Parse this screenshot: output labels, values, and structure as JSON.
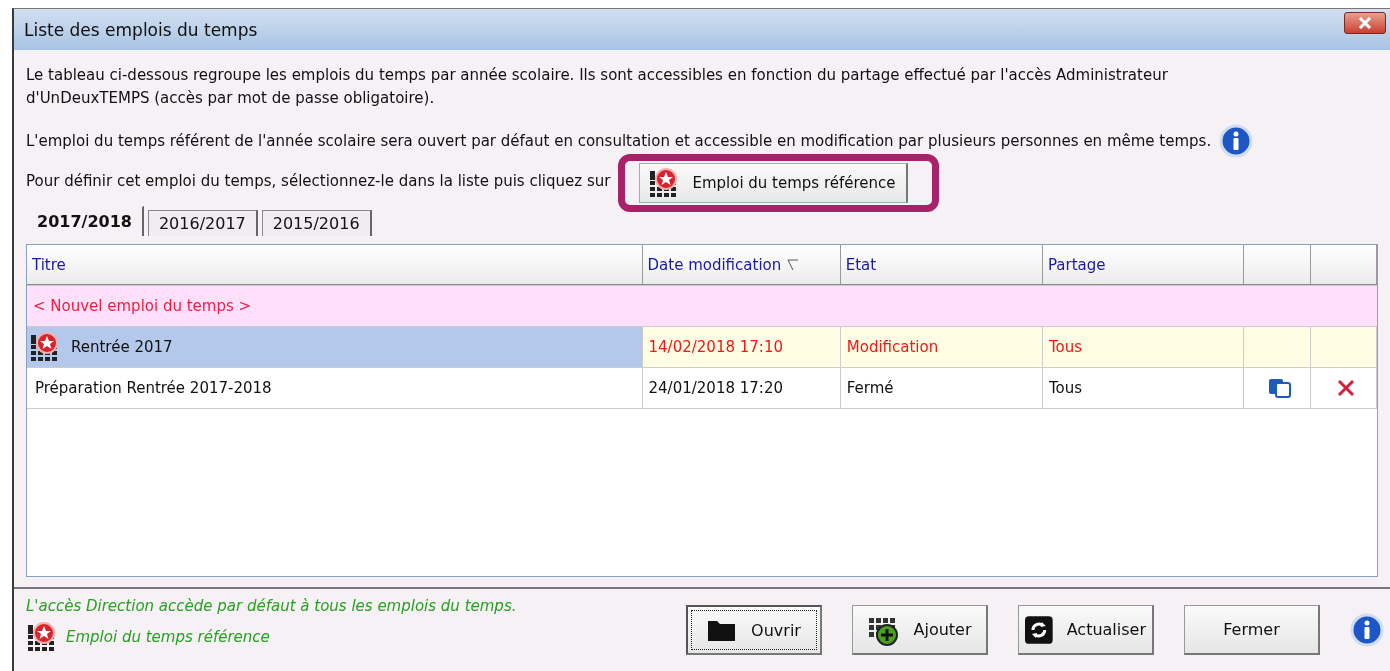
{
  "window": {
    "title": "Liste des emplois du temps"
  },
  "intro": "Le tableau ci-dessous regroupe les emplois du temps par année scolaire. Ils sont accessibles en fonction du partage effectué par l'accès Administrateur d'UnDeuxTEMPS (accès par mot de passe obligatoire).",
  "info_text": "L'emploi du temps référent de l'année scolaire sera ouvert par défaut en consultation et accessible en modification par plusieurs personnes en même temps.",
  "define_text": "Pour définir cet emploi du temps, sélectionnez-le dans la liste puis cliquez sur",
  "reference_button": {
    "label": "Emploi du temps référence",
    "highlighted": true
  },
  "tabs": [
    {
      "label": "2017/2018",
      "selected": true
    },
    {
      "label": "2016/2017",
      "selected": false
    },
    {
      "label": "2015/2016",
      "selected": false
    }
  ],
  "table": {
    "columns": [
      {
        "label": "Titre",
        "sorted": false
      },
      {
        "label": "Date modification",
        "sorted": true
      },
      {
        "label": "Etat",
        "sorted": false
      },
      {
        "label": "Partage",
        "sorted": false
      }
    ],
    "new_row": "< Nouvel emploi du temps >",
    "rows": [
      {
        "title": "Rentrée 2017",
        "reference": true,
        "selected": true,
        "modified": true,
        "date": "14/02/2018 17:10",
        "state": "Modification",
        "share": "Tous",
        "actions": false
      },
      {
        "title": "Préparation Rentrée 2017-2018",
        "reference": false,
        "selected": false,
        "modified": false,
        "date": "24/01/2018 17:20",
        "state": "Fermé",
        "share": "Tous",
        "actions": true
      }
    ]
  },
  "footer": {
    "note": "L'accès Direction accède par défaut à tous les emplois du temps.",
    "legend": "Emploi du temps référence"
  },
  "buttons": [
    {
      "label": "Ouvrir",
      "kind": "open",
      "focused": true
    },
    {
      "label": "Ajouter",
      "kind": "add",
      "focused": false
    },
    {
      "label": "Actualiser",
      "kind": "refresh",
      "focused": false
    },
    {
      "label": "Fermer",
      "kind": "plain",
      "focused": false
    }
  ]
}
